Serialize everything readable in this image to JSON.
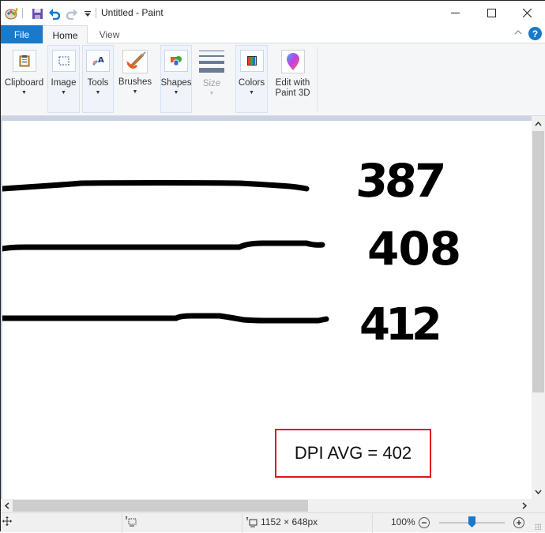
{
  "window": {
    "title": "Untitled - Paint",
    "controls": [
      "minimize",
      "maximize",
      "close"
    ]
  },
  "quick_access": {
    "icons": [
      "paint-app-icon",
      "save-icon",
      "undo-icon",
      "redo-icon",
      "customize-dropdown-icon"
    ]
  },
  "tabs": [
    {
      "label": "File",
      "active": false
    },
    {
      "label": "Home",
      "active": true
    },
    {
      "label": "View",
      "active": false
    }
  ],
  "ribbon": {
    "groups": [
      {
        "label": "Clipboard",
        "icon": "clipboard-icon",
        "has_dropdown": true
      },
      {
        "label": "Image",
        "icon": "select-icon",
        "has_dropdown": true
      },
      {
        "label": "Tools",
        "icon": "tools-icon",
        "has_dropdown": true
      },
      {
        "label": "Brushes",
        "icon": "brush-icon",
        "has_dropdown": true
      },
      {
        "label": "Shapes",
        "icon": "shapes-icon",
        "has_dropdown": true
      },
      {
        "label": "Size",
        "icon": "size-icon",
        "has_dropdown": true,
        "disabled": true
      },
      {
        "label": "Colors",
        "icon": "colors-icon",
        "has_dropdown": true
      },
      {
        "label": "Edit with\nPaint 3D",
        "icon": "paint3d-icon",
        "has_dropdown": false
      }
    ],
    "edit_line1": "Edit with",
    "edit_line2": "Paint 3D"
  },
  "canvas": {
    "handwritten_values": [
      "387",
      "408",
      "412"
    ],
    "annotation_text": "DPI AVG = 402",
    "annotation_border_color": "#e0141c"
  },
  "statusbar": {
    "image_size": "1152 × 648px",
    "zoom_level": "100%",
    "zoom_slider_fraction": 0.5
  },
  "colors": {
    "accent": "#1979ca",
    "file_tab": "#1979ca",
    "help_icon": "#1979ca"
  }
}
